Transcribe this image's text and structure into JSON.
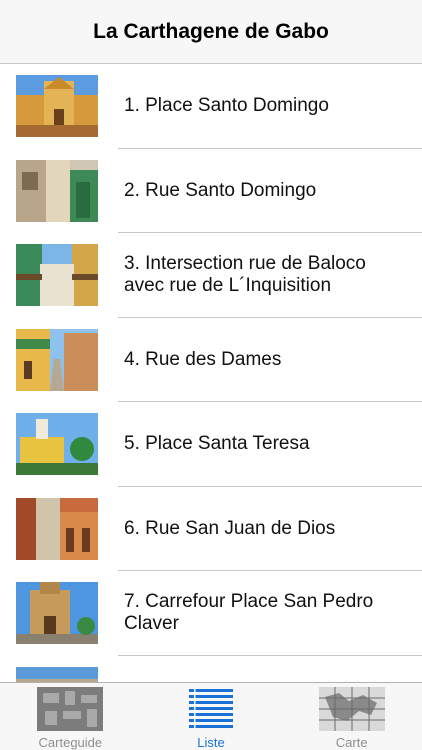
{
  "navbar": {
    "title": "La Carthagene de Gabo"
  },
  "items": [
    {
      "label": "1. Place Santo Domingo"
    },
    {
      "label": "2. Rue Santo Domingo"
    },
    {
      "label": "3. Intersection rue de Baloco avec rue de L´Inquisition"
    },
    {
      "label": "4. Rue des Dames"
    },
    {
      "label": "5. Place Santa Teresa"
    },
    {
      "label": "6. Rue San Juan de Dios"
    },
    {
      "label": "7. Carrefour Place San Pedro Claver"
    },
    {
      "label": ""
    }
  ],
  "tabs": [
    {
      "label": "Carteguide",
      "icon": "map-guide-icon"
    },
    {
      "label": "Liste",
      "icon": "list-icon"
    },
    {
      "label": "Carte",
      "icon": "map-grid-icon"
    }
  ],
  "colors": {
    "accent": "#1a72d6",
    "inactive": "#8e8e93"
  }
}
